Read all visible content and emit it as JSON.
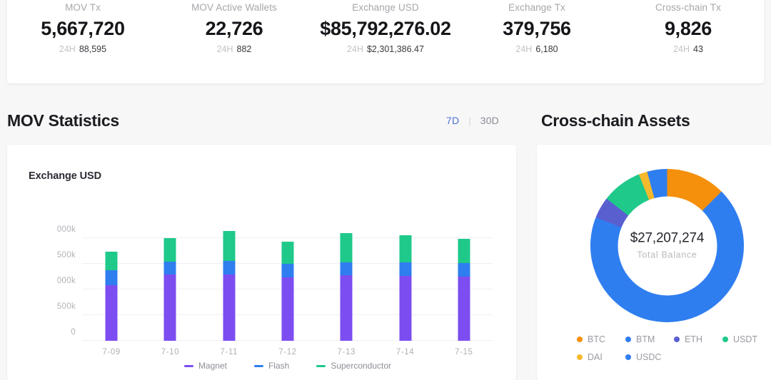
{
  "stats": [
    {
      "label": "MOV Tx",
      "value": "5,667,720",
      "period": "24H",
      "delta": "88,595"
    },
    {
      "label": "MOV Active Wallets",
      "value": "22,726",
      "period": "24H",
      "delta": "882"
    },
    {
      "label": "Exchange USD",
      "value": "$85,792,276.02",
      "period": "24H",
      "delta": "$2,301,386.47"
    },
    {
      "label": "Exchange Tx",
      "value": "379,756",
      "period": "24H",
      "delta": "6,180"
    },
    {
      "label": "Cross-chain Tx",
      "value": "9,826",
      "period": "24H",
      "delta": "43"
    }
  ],
  "sections": {
    "mov_statistics": {
      "title": "MOV Statistics",
      "range_options": [
        {
          "label": "7D",
          "active": true
        },
        {
          "label": "30D",
          "active": false
        }
      ],
      "separator": "|"
    },
    "cross_chain_assets": {
      "title": "Cross-chain Assets"
    }
  },
  "chart_data": [
    {
      "type": "bar",
      "stacked": true,
      "title": "Exchange USD",
      "xlabel": "",
      "ylabel": "",
      "ylim": [
        0,
        2000
      ],
      "yticks": [
        0,
        500,
        1000,
        1500,
        2000
      ],
      "ytick_labels": [
        "0",
        "500k",
        "000k",
        "500k",
        "000k"
      ],
      "grid": true,
      "legend_position": "bottom",
      "categories": [
        "7-09",
        "7-10",
        "7-11",
        "7-12",
        "7-13",
        "7-14",
        "7-15"
      ],
      "series": [
        {
          "name": "Magnet",
          "color": "#7c4df0",
          "values": [
            1080,
            1285,
            1290,
            1230,
            1275,
            1260,
            1255
          ]
        },
        {
          "name": "Flash",
          "color": "#2f7ef0",
          "values": [
            290,
            260,
            270,
            265,
            250,
            265,
            265
          ]
        },
        {
          "name": "Superconductor",
          "color": "#1ec98a",
          "values": [
            370,
            455,
            580,
            440,
            570,
            535,
            460
          ]
        }
      ]
    },
    {
      "type": "pie",
      "variant": "donut",
      "title": "Cross-chain Assets",
      "center_value": "$27,207,274",
      "center_caption": "Total Balance",
      "legend_position": "bottom",
      "labels": [
        "BTC",
        "BTM",
        "ETH",
        "USDT",
        "DAI",
        "USDC"
      ],
      "colors": [
        "#f5900c",
        "#2f7ef0",
        "#5a5fd0",
        "#1ec98a",
        "#f5b92c",
        "#2f7ef0"
      ],
      "percents": [
        12.5,
        68.5,
        4.5,
        8.5,
        1.8,
        4.2
      ]
    }
  ]
}
